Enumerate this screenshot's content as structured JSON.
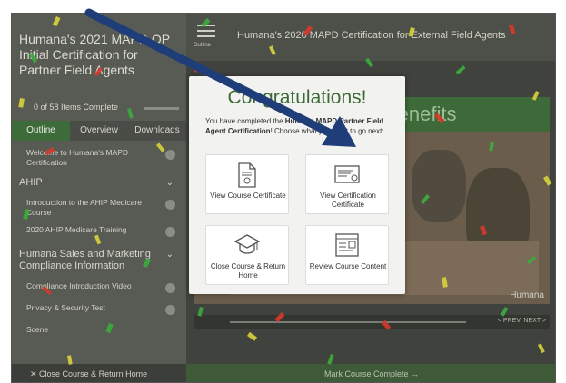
{
  "sidebar": {
    "course_title": "Humana's 2021 MAPD OP Initial Certification for Partner Field Agents",
    "progress_text": "0 of 58 Items Complete",
    "tabs": [
      "Outline",
      "Overview",
      "Downloads"
    ],
    "lessons": [
      {
        "type": "lesson",
        "label": "Welcome to Humana's MAPD Certification"
      },
      {
        "type": "section",
        "label": "AHIP"
      },
      {
        "type": "lesson",
        "label": "Introduction to the AHIP Medicare Course"
      },
      {
        "type": "lesson",
        "label": "2020 AHIP Medicare Training"
      },
      {
        "type": "section",
        "label": "Humana Sales and Marketing Compliance Information"
      },
      {
        "type": "lesson",
        "label": "Compliance Introduction Video"
      },
      {
        "type": "lesson",
        "label": "Privacy & Security Test"
      },
      {
        "type": "lesson",
        "label": "Scene"
      }
    ],
    "close_home": "Close Course & Return Home"
  },
  "main": {
    "menu_label": "Outline",
    "title": "Humana's 2020 MAPD Certification for External Field Agents",
    "video_header": "Benefits",
    "video_logo": "Humana",
    "vc_prev": "< PREV",
    "vc_next": "NEXT >"
  },
  "footer": {
    "mark_complete": "Mark Course Complete →"
  },
  "modal": {
    "title": "Congratulations!",
    "message_pre": "You have completed the ",
    "message_bold": "Humana MAPD Partner Field Agent Certification",
    "message_post": "! Choose what you want to go next:",
    "options": [
      {
        "label": "View Course Certificate",
        "icon": "certificate-icon"
      },
      {
        "label": "View Certification Certificate",
        "icon": "certification-icon"
      },
      {
        "label": "Close Course & Return Home",
        "icon": "graduation-cap-icon"
      },
      {
        "label": "Review Course Content",
        "icon": "course-content-icon"
      }
    ]
  },
  "colors": {
    "accent_green": "#3b6a34",
    "arrow_blue": "#1f3d78"
  }
}
